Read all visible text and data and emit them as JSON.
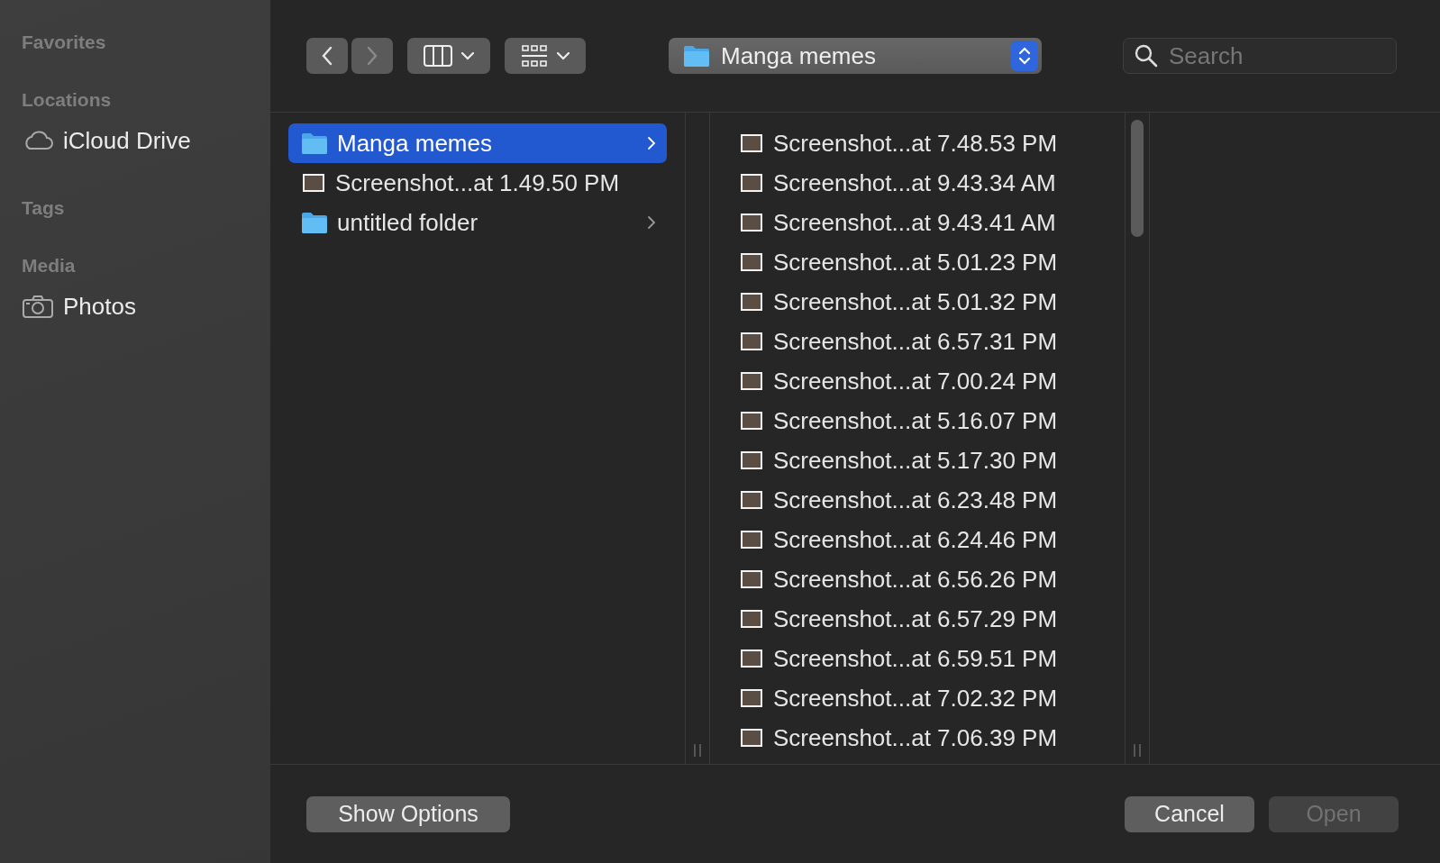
{
  "sidebar": {
    "sections": [
      {
        "heading": "Favorites"
      },
      {
        "heading": "Locations",
        "items": [
          {
            "label": "iCloud Drive",
            "kind": "cloud"
          }
        ]
      },
      {
        "heading": "Tags"
      },
      {
        "heading": "Media",
        "items": [
          {
            "label": "Photos",
            "kind": "camera"
          }
        ]
      }
    ]
  },
  "toolbar": {
    "back": {
      "disabled": false
    },
    "forward": {
      "disabled": true
    },
    "location": "Manga memes",
    "search": {
      "placeholder": "Search"
    }
  },
  "columns": [
    {
      "items": [
        {
          "name": "Manga memes",
          "kind": "folder",
          "selected": true
        },
        {
          "name": "Screenshot...at 1.49.50 PM",
          "kind": "image",
          "selected": false
        },
        {
          "name": "untitled folder",
          "kind": "folder",
          "selected": false
        }
      ]
    },
    {
      "items": [
        {
          "name": "Screenshot...at 7.48.53 PM",
          "kind": "image",
          "selected": false
        },
        {
          "name": "Screenshot...at 9.43.34 AM",
          "kind": "image",
          "selected": false
        },
        {
          "name": "Screenshot...at 9.43.41 AM",
          "kind": "image",
          "selected": false
        },
        {
          "name": "Screenshot...at 5.01.23 PM",
          "kind": "image",
          "selected": false
        },
        {
          "name": "Screenshot...at 5.01.32 PM",
          "kind": "image",
          "selected": false
        },
        {
          "name": "Screenshot...at 6.57.31 PM",
          "kind": "image",
          "selected": false
        },
        {
          "name": "Screenshot...at 7.00.24 PM",
          "kind": "image",
          "selected": false
        },
        {
          "name": "Screenshot...at 5.16.07 PM",
          "kind": "image",
          "selected": false
        },
        {
          "name": "Screenshot...at 5.17.30 PM",
          "kind": "image",
          "selected": false
        },
        {
          "name": "Screenshot...at 6.23.48 PM",
          "kind": "image",
          "selected": false
        },
        {
          "name": "Screenshot...at 6.24.46 PM",
          "kind": "image",
          "selected": false
        },
        {
          "name": "Screenshot...at 6.56.26 PM",
          "kind": "image",
          "selected": false
        },
        {
          "name": "Screenshot...at 6.57.29 PM",
          "kind": "image",
          "selected": false
        },
        {
          "name": "Screenshot...at 6.59.51 PM",
          "kind": "image",
          "selected": false
        },
        {
          "name": "Screenshot...at 7.02.32 PM",
          "kind": "image",
          "selected": false
        },
        {
          "name": "Screenshot...at 7.06.39 PM",
          "kind": "image",
          "selected": false
        }
      ]
    }
  ],
  "footer": {
    "left": [
      {
        "label": "Show Options",
        "disabled": false
      }
    ],
    "right": [
      {
        "label": "Cancel",
        "disabled": false
      },
      {
        "label": "Open",
        "disabled": true
      }
    ]
  }
}
